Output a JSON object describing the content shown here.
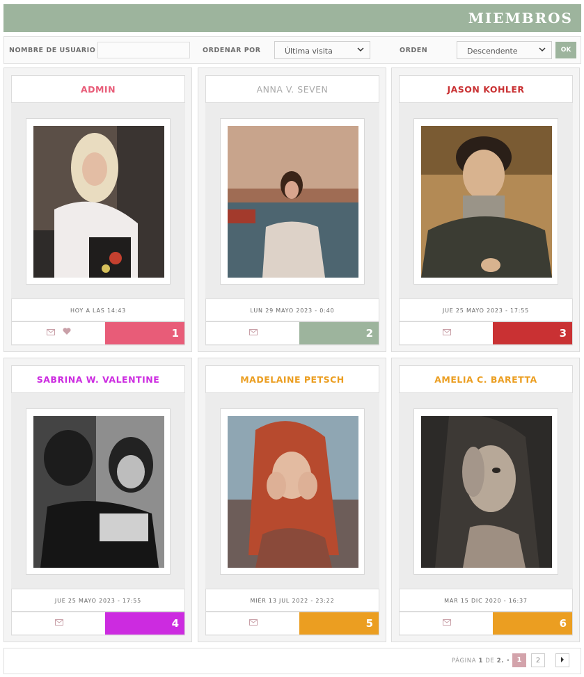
{
  "header": {
    "title": "MIEMBROS"
  },
  "filter": {
    "username_label": "NOMBRE DE USUARIO",
    "username_value": "",
    "sort_label": "ORDENAR POR",
    "sort_value": "Última visita",
    "order_label": "ORDEN",
    "order_value": "Descendente",
    "ok_label": "OK"
  },
  "members": [
    {
      "name": "ADMIN",
      "name_color": "#e85c78",
      "date": "HOY A LAS 14:43",
      "rank": "1",
      "rank_color": "#e85c78",
      "has_heart": true
    },
    {
      "name": "ANNA V. SEVEN",
      "name_color": "#a9a9a9",
      "date": "LUN 29 MAYO 2023 - 0:40",
      "rank": "2",
      "rank_color": "#9db49d",
      "has_heart": false
    },
    {
      "name": "JASON KOHLER",
      "name_color": "#c93133",
      "date": "JUE 25 MAYO 2023 - 17:55",
      "rank": "3",
      "rank_color": "#c93133",
      "has_heart": false
    },
    {
      "name": "SABRINA W. VALENTINE",
      "name_color": "#cc2be0",
      "date": "JUE 25 MAYO 2023 - 17:55",
      "rank": "4",
      "rank_color": "#cc2be0",
      "has_heart": false
    },
    {
      "name": "MADELAINE PETSCH",
      "name_color": "#eb9e21",
      "date": "MIÉR 13 JUL 2022 - 23:22",
      "rank": "5",
      "rank_color": "#eb9e21",
      "has_heart": false
    },
    {
      "name": "AMELIA C. BARETTA",
      "name_color": "#eb9e21",
      "date": "MAR 15 DIC 2020 - 16:37",
      "rank": "6",
      "rank_color": "#eb9e21",
      "has_heart": false
    }
  ],
  "pagination": {
    "prefix": "PÁGINA",
    "current": "1",
    "of_label": "DE",
    "total": "2.",
    "bullet": "•",
    "page2": "2",
    "next_icon": "next-arrow-icon"
  },
  "icons": {
    "mail": "mail-icon",
    "heart": "heart-icon"
  }
}
